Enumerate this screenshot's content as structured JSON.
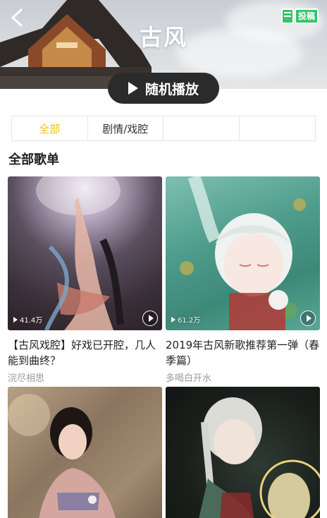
{
  "header": {
    "title": "古风",
    "contribute_label": "投稿",
    "play_all_label": "随机播放"
  },
  "tabs": [
    {
      "label": "全部",
      "active": true
    },
    {
      "label": "剧情/戏腔",
      "active": false
    },
    {
      "label": "",
      "active": false
    },
    {
      "label": "",
      "active": false
    }
  ],
  "section": {
    "title": "全部歌单"
  },
  "playlists": [
    {
      "title": "【古风戏腔】好戏已开腔，几人能到曲终？",
      "author": "浣尽相思",
      "play_count": "41.4万"
    },
    {
      "title": "2019年古风新歌推荐第一弹（春季篇）",
      "author": "多喝白开水",
      "play_count": "61.2万"
    },
    {
      "title": "",
      "author": "",
      "play_count": ""
    },
    {
      "title": "",
      "author": "",
      "play_count": ""
    }
  ],
  "colors": {
    "accent": "#e9c223",
    "play_button_bg": "#2b2b2b",
    "badge_green": "#36c46a"
  }
}
